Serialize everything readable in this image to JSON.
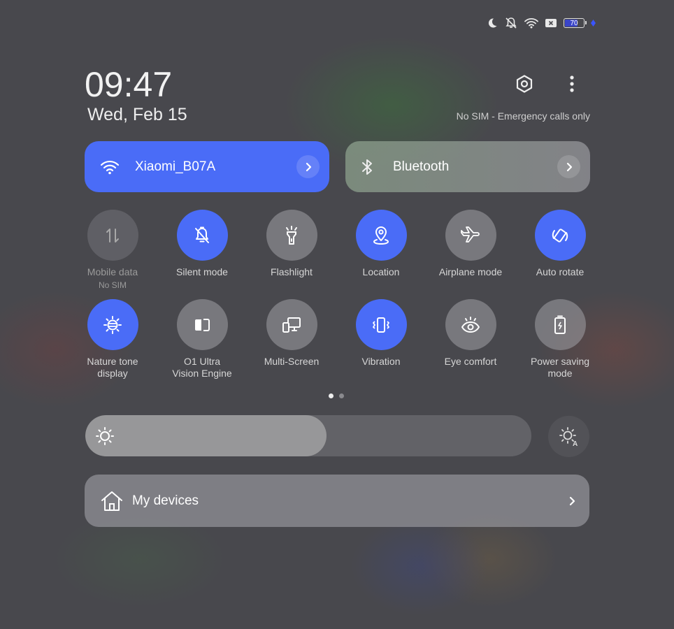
{
  "status_bar": {
    "icons": [
      "moon-icon",
      "bell-off-icon",
      "wifi-icon",
      "no-sim-icon",
      "battery-icon",
      "charging-icon"
    ],
    "battery_level": "70",
    "battery_fraction": 0.7
  },
  "header": {
    "time": "09:47",
    "date": "Wed, Feb 15",
    "sim_status": "No SIM - Emergency calls only",
    "settings_icon": "hexagon-gear-icon",
    "more_icon": "more-vertical-icon"
  },
  "wifi": {
    "label": "Xiaomi_B07A",
    "state": "on",
    "icon": "wifi-icon"
  },
  "bluetooth": {
    "label": "Bluetooth",
    "state": "off",
    "icon": "bluetooth-icon"
  },
  "toggles": [
    {
      "label": "Mobile data",
      "sub": "No SIM",
      "state": "disabled",
      "icon": "mobile-data-icon"
    },
    {
      "label": "Silent mode",
      "state": "on",
      "icon": "bell-off-icon"
    },
    {
      "label": "Flashlight",
      "state": "off",
      "icon": "flashlight-icon"
    },
    {
      "label": "Location",
      "state": "on",
      "icon": "location-icon"
    },
    {
      "label": "Airplane mode",
      "state": "off",
      "icon": "airplane-icon"
    },
    {
      "label": "Auto rotate",
      "state": "on",
      "icon": "rotate-icon"
    },
    {
      "label": "Nature tone\ndisplay",
      "state": "on",
      "icon": "nature-tone-icon"
    },
    {
      "label": "O1 Ultra\nVision Engine",
      "state": "off",
      "icon": "vision-engine-icon"
    },
    {
      "label": "Multi-Screen",
      "state": "off",
      "icon": "multi-screen-icon"
    },
    {
      "label": "Vibration",
      "state": "on",
      "icon": "vibration-icon"
    },
    {
      "label": "Eye comfort",
      "state": "off",
      "icon": "eye-icon"
    },
    {
      "label": "Power saving\nmode",
      "state": "off",
      "icon": "battery-saver-icon"
    }
  ],
  "pagination": {
    "current": 1,
    "total": 2
  },
  "brightness": {
    "level": 0.54,
    "auto": false
  },
  "my_devices": {
    "label": "My devices"
  },
  "colors": {
    "accent": "#4a6cf7",
    "background": "#48484d"
  }
}
